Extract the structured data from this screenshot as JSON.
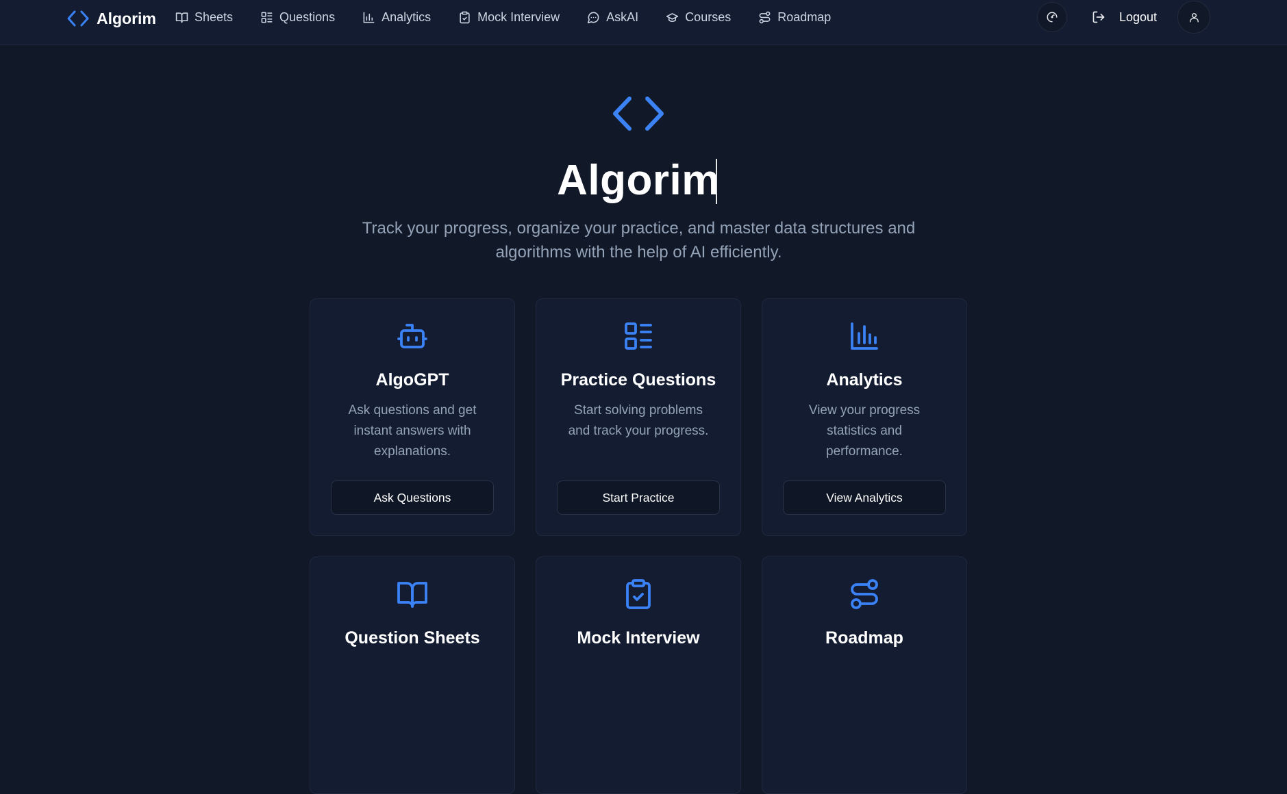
{
  "brand": {
    "name": "Algorim",
    "icon": "code-brackets-icon"
  },
  "nav": [
    {
      "label": "Sheets",
      "icon": "book-open-icon"
    },
    {
      "label": "Questions",
      "icon": "list-icon"
    },
    {
      "label": "Analytics",
      "icon": "bar-chart-icon"
    },
    {
      "label": "Mock Interview",
      "icon": "clipboard-check-icon"
    },
    {
      "label": "AskAI",
      "icon": "message-circle-icon"
    },
    {
      "label": "Courses",
      "icon": "graduation-cap-icon"
    },
    {
      "label": "Roadmap",
      "icon": "route-icon"
    }
  ],
  "header_actions": {
    "theme_icon": "theme-toggle-icon",
    "logout_label": "Logout",
    "logout_icon": "log-out-icon",
    "profile_icon": "user-icon"
  },
  "hero": {
    "title": "Algorim",
    "subtitle": "Track your progress, organize your practice, and master data structures and algorithms with the help of AI efficiently."
  },
  "cards": [
    {
      "title": "AlgoGPT",
      "description": "Ask questions and get instant answers with explanations.",
      "button": "Ask Questions",
      "icon": "bot-icon"
    },
    {
      "title": "Practice Questions",
      "description": "Start solving problems and track your progress.",
      "button": "Start Practice",
      "icon": "list-icon"
    },
    {
      "title": "Analytics",
      "description": "View your progress statistics and performance.",
      "button": "View Analytics",
      "icon": "bar-chart-icon"
    },
    {
      "title": "Question Sheets",
      "icon": "book-open-icon"
    },
    {
      "title": "Mock Interview",
      "icon": "clipboard-check-icon"
    },
    {
      "title": "Roadmap",
      "icon": "route-icon"
    }
  ],
  "colors": {
    "background": "#111827",
    "surface": "#131c31",
    "accent": "#3b82f6",
    "muted_text": "#94a3b8",
    "nav_text": "#cbd5e1"
  }
}
